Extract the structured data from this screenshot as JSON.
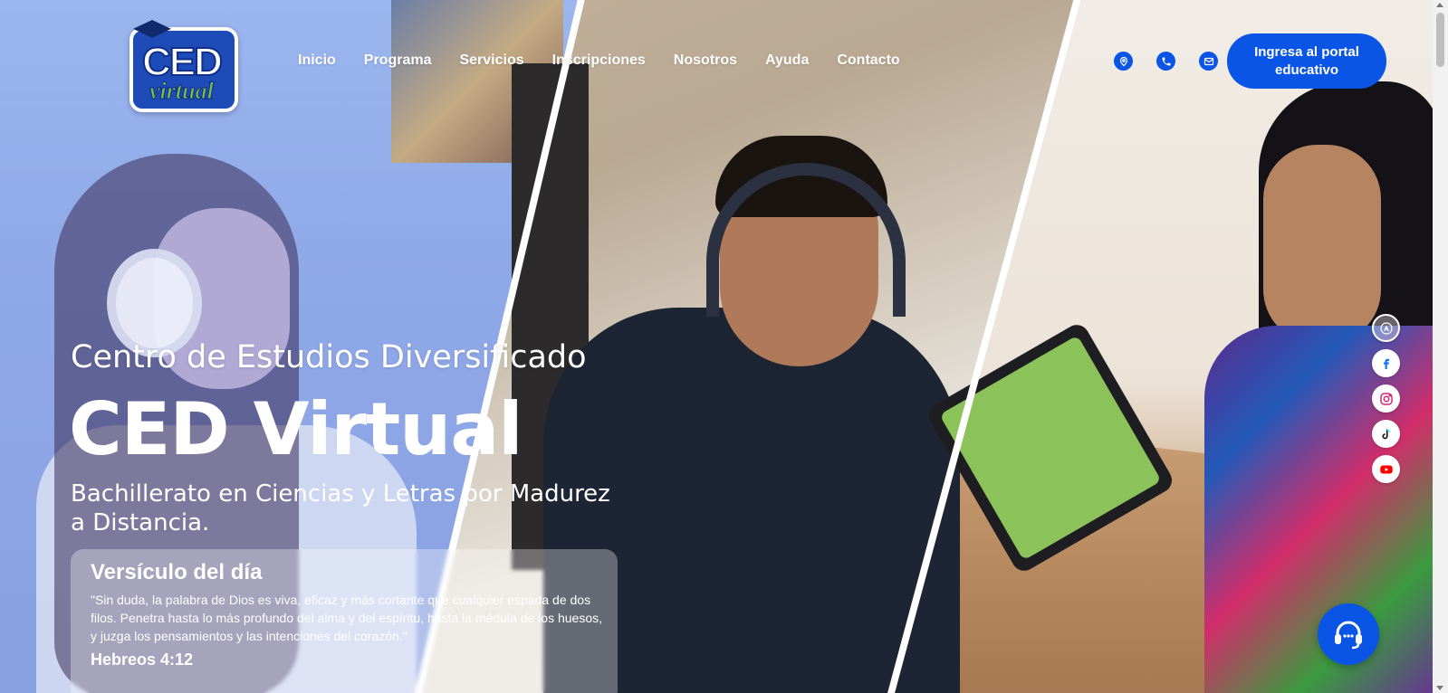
{
  "brand": {
    "logo_text_top": "CED",
    "logo_text_bottom": "virtual",
    "colors": {
      "primary": "#0b55e6",
      "logo_blue": "#1e4bb8",
      "logo_green": "#7cc243"
    }
  },
  "nav": {
    "items": [
      {
        "label": "Inicio"
      },
      {
        "label": "Programa"
      },
      {
        "label": "Servicios"
      },
      {
        "label": "Inscripciones"
      },
      {
        "label": "Nosotros"
      },
      {
        "label": "Ayuda"
      },
      {
        "label": "Contacto"
      }
    ]
  },
  "contact_icons": [
    "location-pin-icon",
    "phone-icon",
    "mail-icon"
  ],
  "portal_button": {
    "label": "Ingresa al portal educativo"
  },
  "hero": {
    "subtitle": "Centro de Estudios Diversificado",
    "title": "CED Virtual",
    "description": "Bachillerato en Ciencias y Letras por Madurez a Distancia."
  },
  "verse": {
    "title": "Versículo del día",
    "text": "\"Sin duda, la palabra de Dios es viva, eficaz y más cortante que cualquier espada de dos filos. Penetra hasta lo más profundo del alma y del espíritu, hasta la médula de los huesos, y juzga los pensamientos y las intenciones del corazón.\"",
    "reference": "Hebreos 4:12"
  },
  "social": [
    "seal-icon",
    "facebook-icon",
    "instagram-icon",
    "tiktok-icon",
    "youtube-icon"
  ],
  "support": {
    "icon": "headset-icon"
  }
}
